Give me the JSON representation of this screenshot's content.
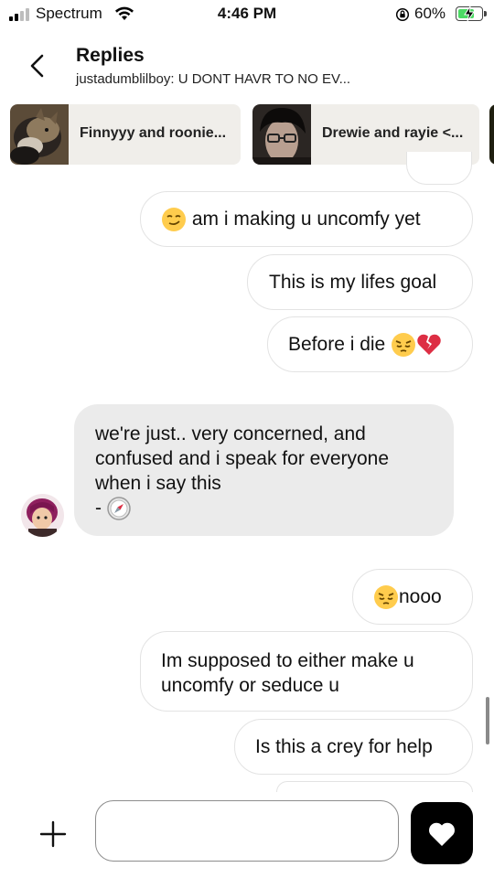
{
  "status_bar": {
    "carrier": "Spectrum",
    "time": "4:46 PM",
    "battery_percent": "60%",
    "battery_level": 0.6,
    "icons": [
      "signal-icon",
      "wifi-icon",
      "orientation-lock-icon",
      "battery-charging-icon"
    ]
  },
  "header": {
    "title": "Replies",
    "subtitle": "justadumblilboy: U DONT HAVR TO NO EV...",
    "back_icon": "chevron-left-icon"
  },
  "reply_threads": [
    {
      "label": "Finnyyy and roonie..."
    },
    {
      "label": "Drewie and rayie <..."
    }
  ],
  "messages": [
    {
      "direction": "out",
      "text": "am i making u uncomfy yet",
      "emoji_before": "smirk"
    },
    {
      "direction": "out",
      "text": "This is my lifes goal"
    },
    {
      "direction": "out",
      "text": "Before i die",
      "emoji_after": [
        "pensive",
        "broken-heart"
      ]
    },
    {
      "direction": "in",
      "lines": [
        "we're just.. very concerned, and",
        "confused and i speak for everyone",
        "when i say this",
        "- "
      ],
      "emoji_after": "compass"
    },
    {
      "direction": "out",
      "text": "nooo",
      "emoji_before": "pensive"
    },
    {
      "direction": "out",
      "lines": [
        "Im supposed to either make u",
        "uncomfy or seduce u"
      ]
    },
    {
      "direction": "out",
      "text": "Is this a crey for help"
    }
  ],
  "composer": {
    "placeholder": "",
    "add_icon": "plus-icon",
    "send_icon": "heart-icon"
  },
  "colors": {
    "incoming_bubble": "#ebebeb",
    "outgoing_border": "#e3e3e3",
    "battery_fill": "#4cd964",
    "send_button": "#000000"
  }
}
